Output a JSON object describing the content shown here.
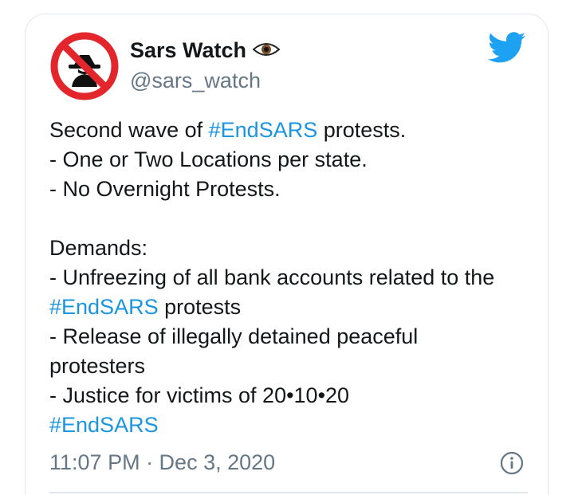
{
  "author": {
    "display_name": "Sars Watch",
    "handle": "@sars_watch",
    "name_emoji": "eye-icon"
  },
  "tweet": {
    "lines": [
      [
        "Second wave of ",
        "#EndSARS",
        " protests."
      ],
      [
        "- One or Two Locations per state."
      ],
      [
        "- No Overnight Protests."
      ],
      [
        ""
      ],
      [
        "Demands:"
      ],
      [
        "- Unfreezing of all bank accounts related to the"
      ],
      [
        "#EndSARS",
        " protests"
      ],
      [
        "- Release of illegally detained peaceful"
      ],
      [
        "protesters"
      ],
      [
        "- Justice for victims of 20•10•20"
      ],
      [
        "#EndSARS"
      ]
    ],
    "l0_a": "Second wave of ",
    "l0_tag": "#EndSARS",
    "l0_b": " protests.",
    "l1": "- One or Two Locations per state.",
    "l2": "- No Overnight Protests.",
    "l4": "Demands:",
    "l5": "- Unfreezing of all bank accounts related to the",
    "l6_tag": "#EndSARS",
    "l6_b": " protests",
    "l7": "- Release of illegally detained peaceful",
    "l8": "protesters",
    "l9": "- Justice for victims of 20•10•20",
    "l10_tag": "#EndSARS",
    "timestamp": "11:07 PM · Dec 3, 2020"
  },
  "colors": {
    "hashtag": "#1b95e0",
    "twitter_blue": "#1da1f2",
    "muted": "#657786",
    "text": "#14171a",
    "avatar_red": "#e3262b"
  },
  "icons": {
    "avatar": "no-spy-avatar",
    "brand": "twitter-bird-icon",
    "info": "info-icon"
  }
}
